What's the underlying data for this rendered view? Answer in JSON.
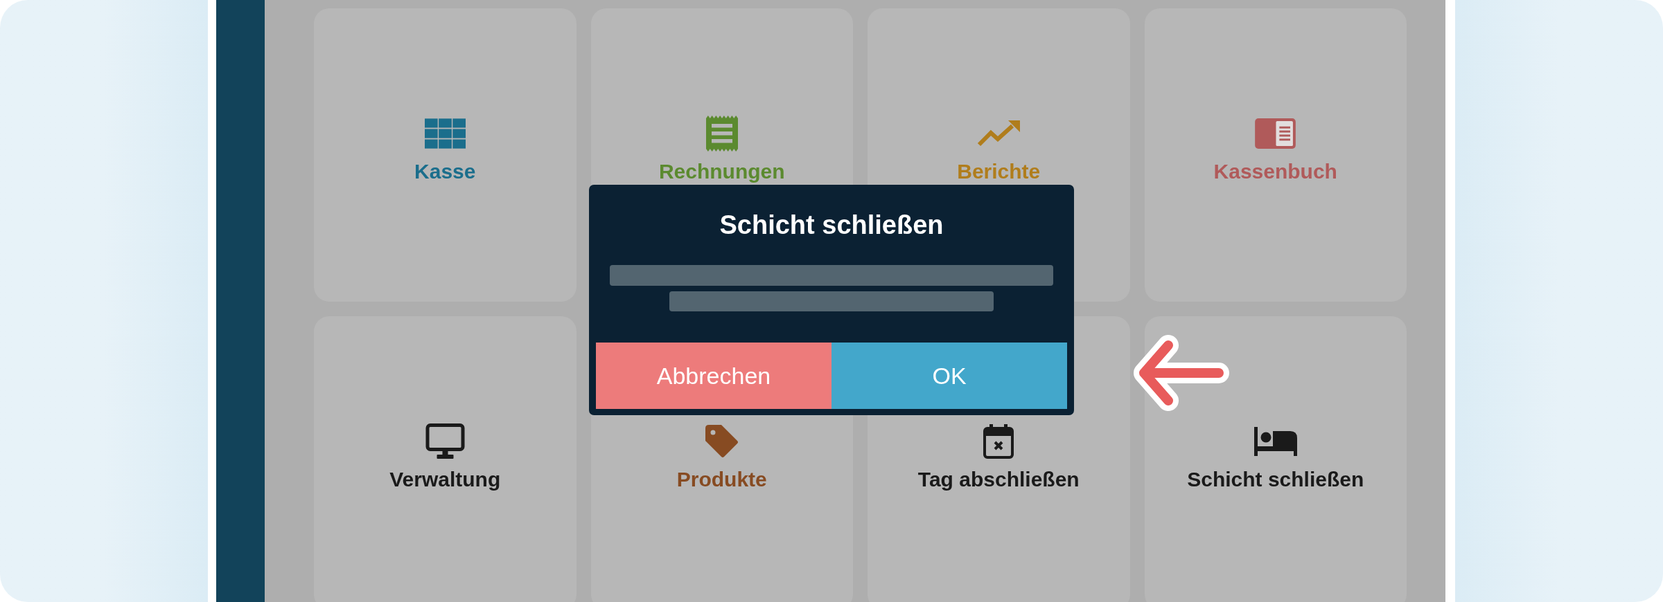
{
  "tiles": [
    {
      "label": "Kasse",
      "color": "#1b6e8c"
    },
    {
      "label": "Rechnungen",
      "color": "#5b8a2f"
    },
    {
      "label": "Berichte",
      "color": "#b07d1c"
    },
    {
      "label": "Kassenbuch",
      "color": "#b05a5a"
    },
    {
      "label": "Verwaltung",
      "color": "#1a1a1a"
    },
    {
      "label": "Produkte",
      "color": "#874b22"
    },
    {
      "label": "Tag abschließen",
      "color": "#1a1a1a"
    },
    {
      "label": "Schicht schließen",
      "color": "#1a1a1a"
    }
  ],
  "dialog": {
    "title": "Schicht schließen",
    "buttons": [
      {
        "label": "Abbrechen",
        "kind": "cancel"
      },
      {
        "label": "OK",
        "kind": "confirm"
      }
    ]
  }
}
